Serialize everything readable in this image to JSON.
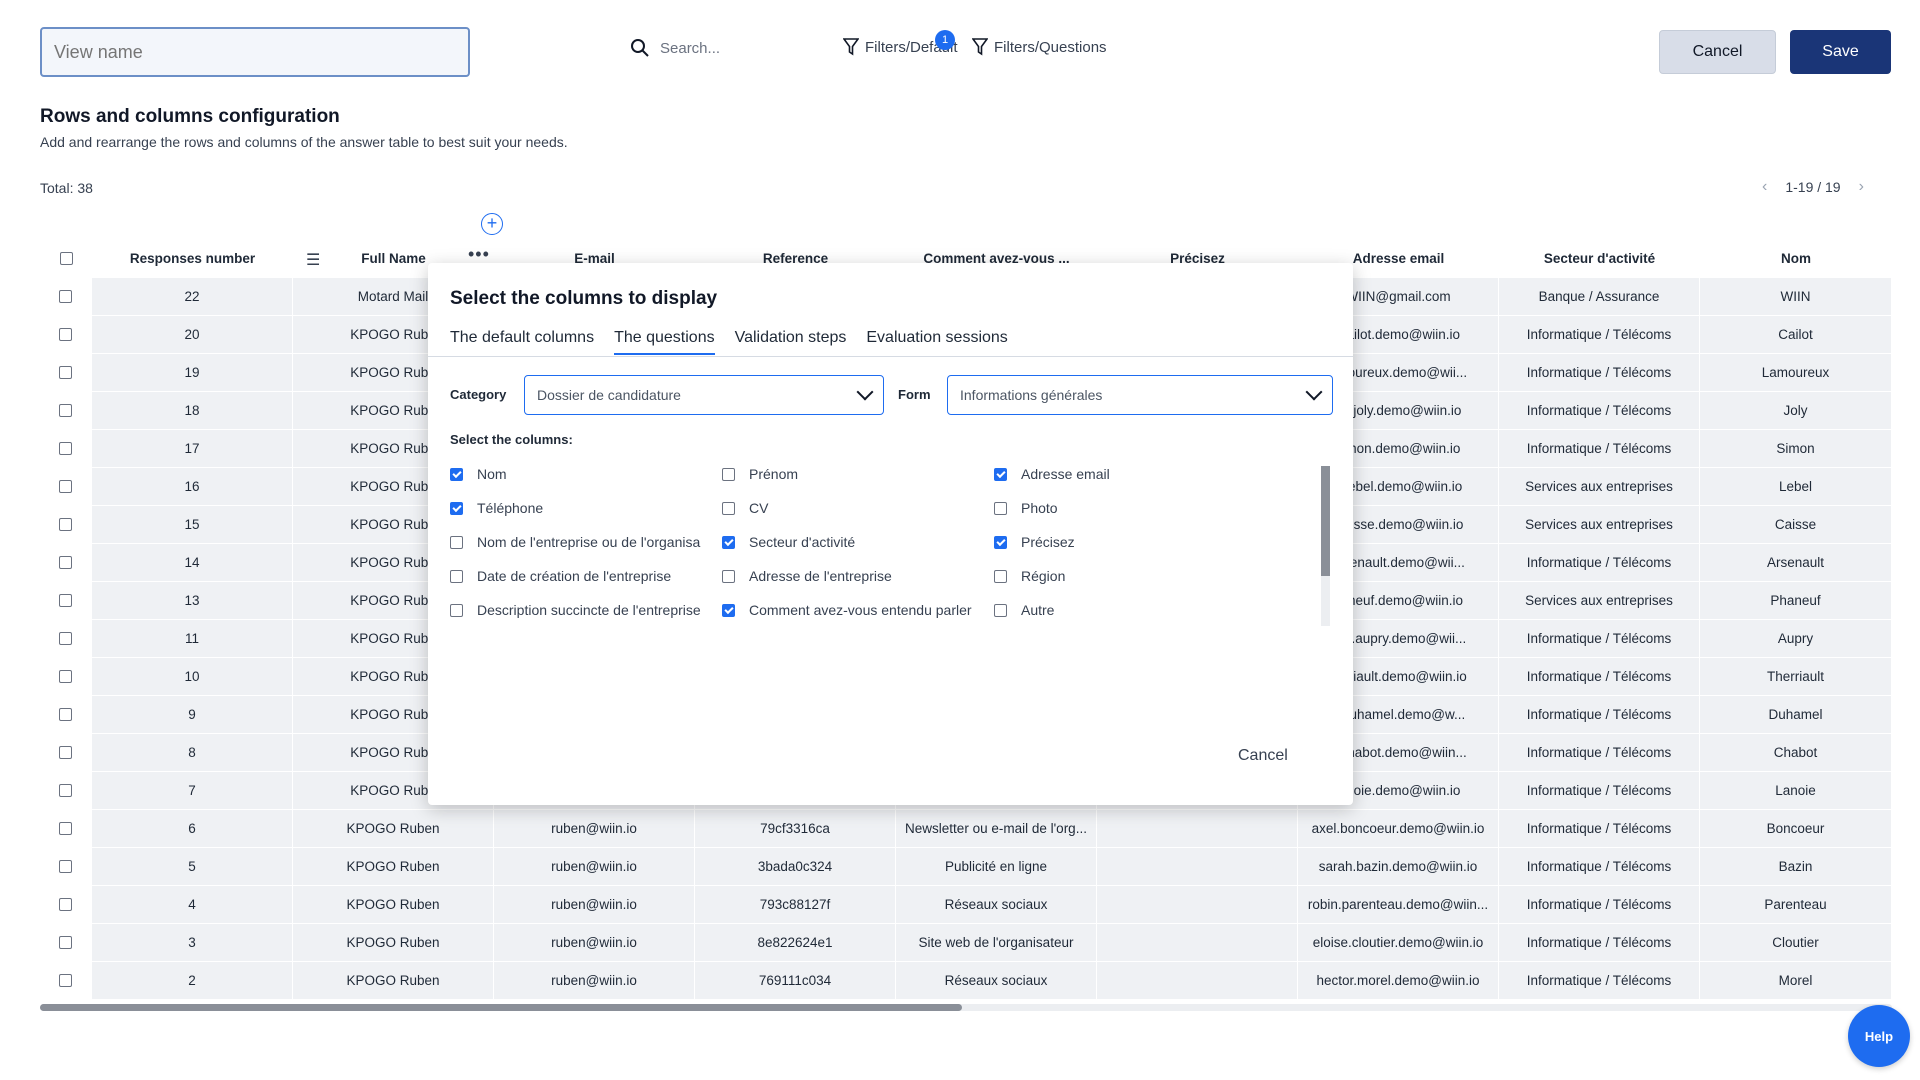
{
  "toolbar": {
    "view_name_placeholder": "View name",
    "search_placeholder": "Search...",
    "filters_default": "Filters/Default",
    "filters_default_count": "1",
    "filters_questions": "Filters/Questions",
    "cancel_label": "Cancel",
    "save_label": "Save"
  },
  "section": {
    "title": "Rows and columns configuration",
    "description": "Add and rearrange the rows and columns of the answer table to best suit your needs."
  },
  "total": "Total: 38",
  "pagination": "1-19 / 19",
  "table": {
    "headers": [
      "Responses number",
      "Full Name",
      "E-mail",
      "Reference",
      "Comment avez-vous ...",
      "Précisez",
      "Adresse email",
      "Secteur d'activité",
      "Nom"
    ],
    "rows": [
      [
        "22",
        "Motard Mail",
        "",
        "",
        "",
        "",
        "WIIN@gmail.com",
        "Banque / Assurance",
        "WIIN"
      ],
      [
        "20",
        "KPOGO Rube",
        "",
        "",
        "",
        "",
        ".cailot.demo@wiin.io",
        "Informatique / Télécoms",
        "Cailot"
      ],
      [
        "19",
        "KPOGO Rube",
        "",
        "",
        "",
        "",
        "amoureux.demo@wii...",
        "Informatique / Télécoms",
        "Lamoureux"
      ],
      [
        "18",
        "KPOGO Rube",
        "",
        "",
        "",
        "",
        "ne.joly.demo@wiin.io",
        "Informatique / Télécoms",
        "Joly"
      ],
      [
        "17",
        "KPOGO Rube",
        "",
        "",
        "",
        "",
        "simon.demo@wiin.io",
        "Informatique / Télécoms",
        "Simon"
      ],
      [
        "16",
        "KPOGO Rube",
        "",
        "",
        "",
        "",
        "n.lebel.demo@wiin.io",
        "Services aux entreprises",
        "Lebel"
      ],
      [
        "15",
        "KPOGO Rube",
        "",
        "",
        "",
        "",
        ".caisse.demo@wiin.io",
        "Services aux entreprises",
        "Caisse"
      ],
      [
        "14",
        "KPOGO Rube",
        "",
        "",
        "",
        "",
        "arsenault.demo@wii...",
        "Informatique / Télécoms",
        "Arsenault"
      ],
      [
        "13",
        "KPOGO Rube",
        "",
        "",
        "",
        "",
        "haneuf.demo@wiin.io",
        "Services aux entreprises",
        "Phaneuf"
      ],
      [
        "11",
        "KPOGO Rube",
        "",
        "",
        "",
        "",
        "nce.aupry.demo@wii...",
        "Informatique / Télécoms",
        "Aupry"
      ],
      [
        "10",
        "KPOGO Rube",
        "",
        "",
        "",
        "",
        "herriault.demo@wiin.io",
        "Informatique / Télécoms",
        "Therriault"
      ],
      [
        "9",
        "KPOGO Rube",
        "",
        "",
        "",
        "",
        "e.duhamel.demo@w...",
        "Informatique / Télécoms",
        "Duhamel"
      ],
      [
        "8",
        "KPOGO Rube",
        "",
        "",
        "",
        "",
        "o.chabot.demo@wiin...",
        "Informatique / Télécoms",
        "Chabot"
      ],
      [
        "7",
        "KPOGO Rube",
        "",
        "",
        "",
        "",
        "lanoie.demo@wiin.io",
        "Informatique / Télécoms",
        "Lanoie"
      ],
      [
        "6",
        "KPOGO Ruben",
        "ruben@wiin.io",
        "79cf3316ca",
        "Newsletter ou e-mail de l'org...",
        "",
        "axel.boncoeur.demo@wiin.io",
        "Informatique / Télécoms",
        "Boncoeur"
      ],
      [
        "5",
        "KPOGO Ruben",
        "ruben@wiin.io",
        "3bada0c324",
        "Publicité en ligne",
        "",
        "sarah.bazin.demo@wiin.io",
        "Informatique / Télécoms",
        "Bazin"
      ],
      [
        "4",
        "KPOGO Ruben",
        "ruben@wiin.io",
        "793c88127f",
        "Réseaux sociaux",
        "",
        "robin.parenteau.demo@wiin...",
        "Informatique / Télécoms",
        "Parenteau"
      ],
      [
        "3",
        "KPOGO Ruben",
        "ruben@wiin.io",
        "8e822624e1",
        "Site web de l'organisateur",
        "",
        "eloise.cloutier.demo@wiin.io",
        "Informatique / Télécoms",
        "Cloutier"
      ],
      [
        "2",
        "KPOGO Ruben",
        "ruben@wiin.io",
        "769111c034",
        "Réseaux sociaux",
        "",
        "hector.morel.demo@wiin.io",
        "Informatique / Télécoms",
        "Morel"
      ]
    ]
  },
  "modal": {
    "title": "Select the columns to display",
    "tabs": [
      "The default columns",
      "The questions",
      "Validation steps",
      "Evaluation sessions"
    ],
    "active_tab": "The questions",
    "category_label": "Category",
    "category_value": "Dossier de candidature",
    "form_label": "Form",
    "form_value": "Informations générales",
    "select_columns_label": "Select the columns:",
    "columns": [
      {
        "label": "Nom",
        "checked": true
      },
      {
        "label": "Téléphone",
        "checked": true
      },
      {
        "label": "Nom de l'entreprise ou de l'organisa",
        "checked": false
      },
      {
        "label": "Date de création de l'entreprise",
        "checked": false
      },
      {
        "label": "Description succincte de l'entreprise",
        "checked": false
      },
      {
        "label": "Prénom",
        "checked": false
      },
      {
        "label": "CV",
        "checked": false
      },
      {
        "label": "Secteur d'activité",
        "checked": true
      },
      {
        "label": "Adresse de l'entreprise",
        "checked": false
      },
      {
        "label": "Comment avez-vous entendu parler",
        "checked": true
      },
      {
        "label": "Adresse email",
        "checked": true
      },
      {
        "label": "Photo",
        "checked": false
      },
      {
        "label": "Précisez",
        "checked": true
      },
      {
        "label": "Région",
        "checked": false
      },
      {
        "label": "Autre",
        "checked": false
      }
    ],
    "cancel_label": "Cancel"
  },
  "help_label": "Help",
  "colors": {
    "accent": "#1e6cf0",
    "save_button": "#1a3577",
    "cancel_button": "#d8dde8",
    "row_background": "#eff1f4"
  }
}
